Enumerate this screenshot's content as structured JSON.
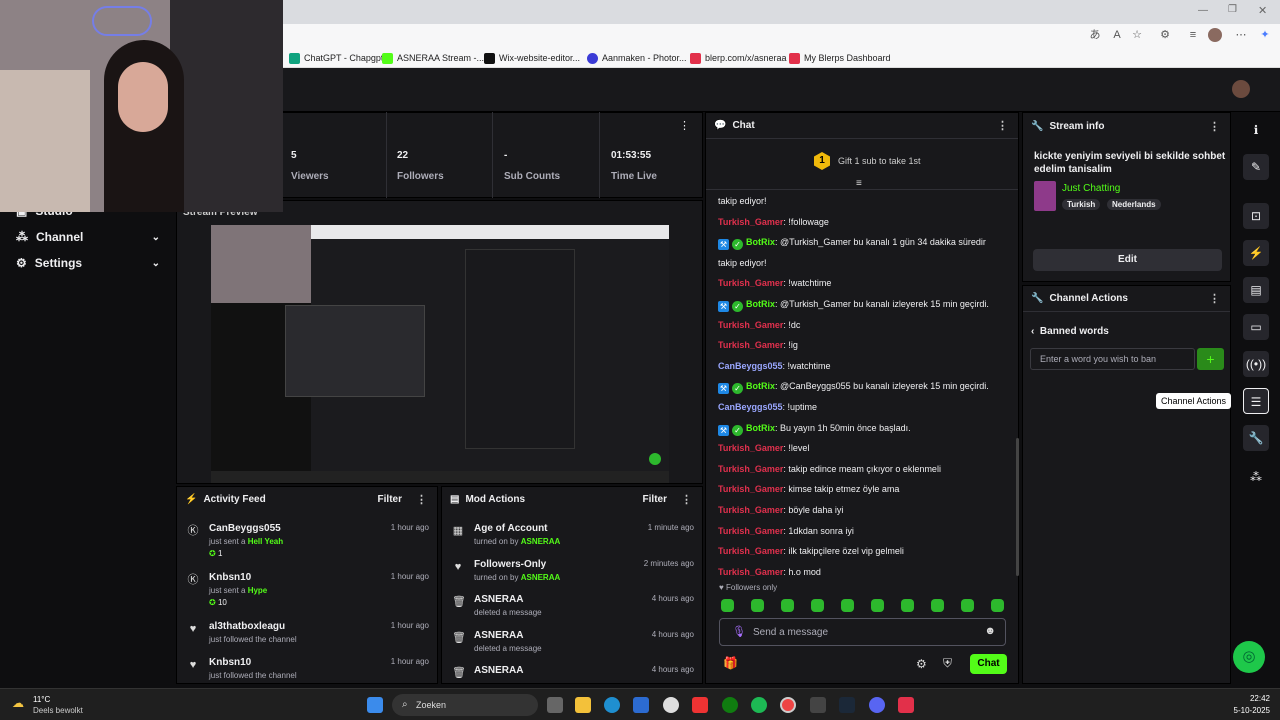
{
  "browser": {
    "bookmarks": [
      "ChatGPT - Chapgpt",
      "ASNERAA Stream -...",
      "Wix-website-editor...",
      "Aanmaken - Photor...",
      "blerp.com/x/asneraa",
      "My Blerps Dashboard"
    ],
    "bookmark_colors": [
      "#10a37f",
      "#53fc18",
      "#111111",
      "#3b3bd6",
      "#e2304a",
      "#e2304a"
    ]
  },
  "stats": {
    "viewers_value": "5",
    "viewers_label": "Viewers",
    "followers_value": "22",
    "followers_label": "Followers",
    "subs_value": "-",
    "subs_label": "Sub Counts",
    "time_value": "01:53:55",
    "time_label": "Time Live"
  },
  "left_nav": {
    "studio": "Studio",
    "channel": "Channel",
    "settings": "Settings"
  },
  "preview": {
    "title": "Stream Preview"
  },
  "chat": {
    "title": "Chat",
    "gift_text": "Gift 1 sub to take 1st",
    "gift_count": "1",
    "messages": [
      {
        "user": "",
        "text": "takip ediyor!",
        "color": "#efeff1",
        "bot": false
      },
      {
        "user": "Turkish_Gamer",
        "text": ": !followage",
        "color": "#e0304d",
        "bot": false
      },
      {
        "user": "BotRix",
        "text": ": @Turkish_Gamer bu kanalı 1 gün 34 dakika süredir",
        "color": "#53fc18",
        "bot": true
      },
      {
        "user": "",
        "text": "takip ediyor!",
        "color": "#efeff1",
        "bot": false
      },
      {
        "user": "Turkish_Gamer",
        "text": ": !watchtime",
        "color": "#e0304d",
        "bot": false
      },
      {
        "user": "BotRix",
        "text": ": @Turkish_Gamer bu kanalı izleyerek 15 min geçirdi.",
        "color": "#53fc18",
        "bot": true
      },
      {
        "user": "Turkish_Gamer",
        "text": ": !dc",
        "color": "#e0304d",
        "bot": false
      },
      {
        "user": "Turkish_Gamer",
        "text": ": !ig",
        "color": "#e0304d",
        "bot": false
      },
      {
        "user": "CanBeyggs055",
        "text": ": !watchtime",
        "color": "#9aa7ff",
        "bot": false
      },
      {
        "user": "BotRix",
        "text": ": @CanBeyggs055 bu kanalı izleyerek 15 min geçirdi.",
        "color": "#53fc18",
        "bot": true
      },
      {
        "user": "CanBeyggs055",
        "text": ": !uptime",
        "color": "#9aa7ff",
        "bot": false
      },
      {
        "user": "BotRix",
        "text": ": Bu yayın 1h 50min önce başladı.",
        "color": "#53fc18",
        "bot": true
      },
      {
        "user": "Turkish_Gamer",
        "text": ": !level",
        "color": "#e0304d",
        "bot": false
      },
      {
        "user": "Turkish_Gamer",
        "text": ": takip edince meam çıkıyor o eklenmeli",
        "color": "#e0304d",
        "bot": false
      },
      {
        "user": "Turkish_Gamer",
        "text": ": kimse takip etmez öyle ama",
        "color": "#e0304d",
        "bot": false
      },
      {
        "user": "Turkish_Gamer",
        "text": ": böyle daha iyi",
        "color": "#e0304d",
        "bot": false
      },
      {
        "user": "Turkish_Gamer",
        "text": ": 1dkdan sonra iyi",
        "color": "#e0304d",
        "bot": false
      },
      {
        "user": "Turkish_Gamer",
        "text": ": ilk takipçilere özel vip gelmeli",
        "color": "#e0304d",
        "bot": false
      },
      {
        "user": "Turkish_Gamer",
        "text": ": h.o mod",
        "color": "#e0304d",
        "bot": false
      }
    ],
    "followers_only": "Followers only",
    "input_placeholder": "Send a message",
    "send_label": "Chat"
  },
  "stream_info": {
    "title": "Stream info",
    "stream_title": "kickte yeniyim seviyeli bi sekilde sohbet edelim tanisalim",
    "category": "Just Chatting",
    "tags": [
      "Turkish",
      "Nederlands"
    ],
    "edit_label": "Edit"
  },
  "channel_actions": {
    "title": "Channel Actions",
    "back_label": "Banned words",
    "input_placeholder": "Enter a word you wish to ban",
    "add_label": "+",
    "tooltip": "Channel Actions"
  },
  "activity_feed": {
    "title": "Activity Feed",
    "filter_label": "Filter",
    "items": [
      {
        "name": "CanBeyggs055",
        "action": "just sent a ",
        "highlight": "Hell Yeah",
        "count": "1",
        "time": "1 hour ago"
      },
      {
        "name": "Knbsn10",
        "action": "just sent a ",
        "highlight": "Hype",
        "count": "10",
        "time": "1 hour ago"
      },
      {
        "name": "al3thatboxleagu",
        "action": "just followed the channel",
        "highlight": "",
        "count": "",
        "time": "1 hour ago"
      },
      {
        "name": "Knbsn10",
        "action": "just followed the channel",
        "highlight": "",
        "count": "",
        "time": "1 hour ago"
      }
    ]
  },
  "mod_actions": {
    "title": "Mod Actions",
    "filter_label": "Filter",
    "items": [
      {
        "name": "Age of Account",
        "action": "turned on by ",
        "mod": "ASNERAA",
        "time": "1 minute ago"
      },
      {
        "name": "Followers-Only",
        "action": "turned on by ",
        "mod": "ASNERAA",
        "time": "2 minutes ago"
      },
      {
        "name": "ASNERAA",
        "action": "deleted a message",
        "mod": "",
        "time": "4 hours ago"
      },
      {
        "name": "ASNERAA",
        "action": "deleted a message",
        "mod": "",
        "time": "4 hours ago"
      },
      {
        "name": "ASNERAA",
        "action": "",
        "mod": "",
        "time": "4 hours ago"
      }
    ]
  },
  "taskbar": {
    "weather_temp": "11°C",
    "weather_desc": "Deels bewolkt",
    "search": "Zoeken",
    "time": "22:42",
    "date": "5-10-2025"
  },
  "colors": {
    "accent": "#53fc18",
    "bg": "#0e0e10",
    "panel": "#18181b"
  }
}
